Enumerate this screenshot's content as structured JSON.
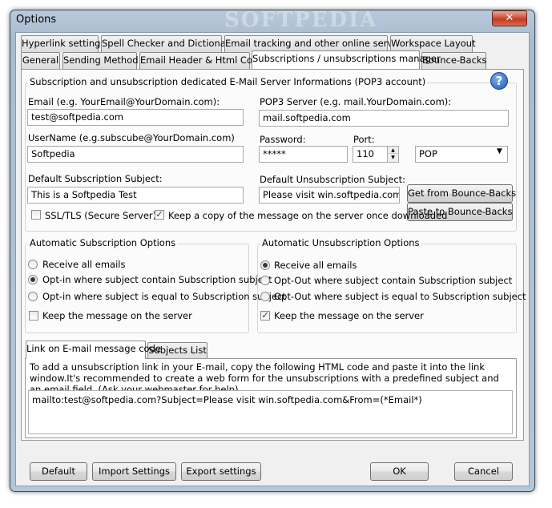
{
  "window": {
    "title": "Options",
    "watermark": "SOFTPEDIA",
    "close_glyph": "✕"
  },
  "tabs_row1": [
    {
      "label": "Hyperlink settings"
    },
    {
      "label": "Spell Checker and Dictionary"
    },
    {
      "label": "Email tracking and other online services"
    },
    {
      "label": "Workspace Layout"
    }
  ],
  "tabs_row2": [
    {
      "label": "General"
    },
    {
      "label": "Sending Method"
    },
    {
      "label": "Email Header & Html Code"
    },
    {
      "label": "Subscriptions / unsubscriptions manager",
      "active": true
    },
    {
      "label": "Bounce-Backs"
    }
  ],
  "server": {
    "section_title": "Subscription and unsubscription dedicated E-Mail Server Informations (POP3 account)",
    "help_glyph": "?",
    "email_label": "Email (e.g. YourEmail@YourDomain.com):",
    "email_value": "test@softpedia.com",
    "pop3_label": "POP3 Server (e.g. mail.YourDomain.com):",
    "pop3_value": "mail.softpedia.com",
    "username_label": "UserName (e.g.subscube@YourDomain.com)",
    "username_value": "Softpedia",
    "password_label": "Password:",
    "password_value": "*****",
    "port_label": "Port:",
    "port_value": "110",
    "protocol_value": "POP",
    "sub_subject_label": "Default Subscription Subject:",
    "sub_subject_value": "This is a Softpedia Test",
    "unsub_subject_label": "Default Unsubscription Subject:",
    "unsub_subject_value": "Please visit win.softpedia.com",
    "get_bounce_label": "Get from Bounce-Backs",
    "paste_bounce_label": "Paste to Bounce-Backs",
    "ssl_label": "SSL/TLS (Secure Server)",
    "ssl_checked": false,
    "keep_copy_label": "Keep a copy of the message on the server once downloaded",
    "keep_copy_checked": true
  },
  "auto_sub": {
    "title": "Automatic Subscription Options",
    "options": [
      {
        "label": "Receive all emails",
        "selected": false
      },
      {
        "label": "Opt-in where subject contain Subscription subject",
        "selected": true
      },
      {
        "label": "Opt-in where subject is equal to Subscription subject",
        "selected": false
      }
    ],
    "keep_label": "Keep the message on the server",
    "keep_checked": false
  },
  "auto_unsub": {
    "title": "Automatic Unsubscription Options",
    "options": [
      {
        "label": "Receive all emails",
        "selected": true
      },
      {
        "label": "Opt-Out where subject contain Subscription subject",
        "selected": false
      },
      {
        "label": "Opt-Out where subject is equal to Subscription subject",
        "selected": false
      }
    ],
    "keep_label": "Keep the message on the server",
    "keep_checked": true
  },
  "bottom_tabs": [
    {
      "label": "Link on E-mail message code",
      "active": true
    },
    {
      "label": "Subjects List",
      "active": false
    }
  ],
  "link_code": {
    "info": "To add a unsubscription link in your E-mail, copy the following HTML code and paste it into the link window.It's recommended to create a web form for the unsubscriptions with a predefined subject and an email field. (Ask your webmaster for help)",
    "code": "mailto:test@softpedia.com?Subject=Please visit win.softpedia.com&From=(*Email*)"
  },
  "footer": {
    "default_label": "Default",
    "import_label": "Import Settings",
    "export_label": "Export settings",
    "ok_label": "OK",
    "cancel_label": "Cancel"
  }
}
